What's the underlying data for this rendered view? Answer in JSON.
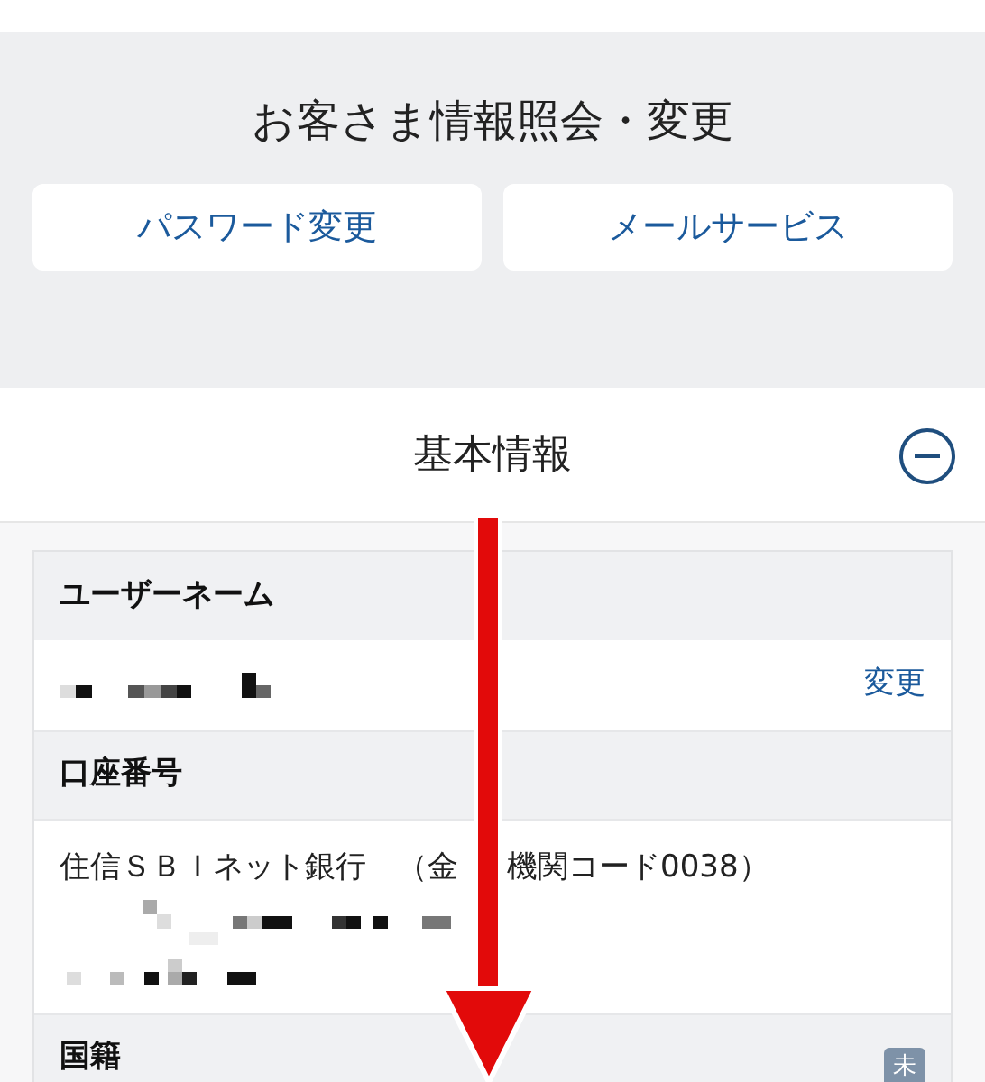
{
  "page_title": "お客さま情報照会・変更",
  "buttons": [
    {
      "label": "パスワード変更"
    },
    {
      "label": "メールサービス"
    }
  ],
  "section": {
    "title": "基本情報",
    "expanded": true
  },
  "fields": [
    {
      "label": "ユーザーネーム",
      "kind": "redacted",
      "action": "変更"
    },
    {
      "label": "口座番号",
      "kind": "account",
      "bank": "住信ＳＢＩネット銀行　（金",
      "bank_rest": "機関コード0038）"
    },
    {
      "label": "国籍",
      "kind": "badge",
      "badge": "未"
    }
  ]
}
